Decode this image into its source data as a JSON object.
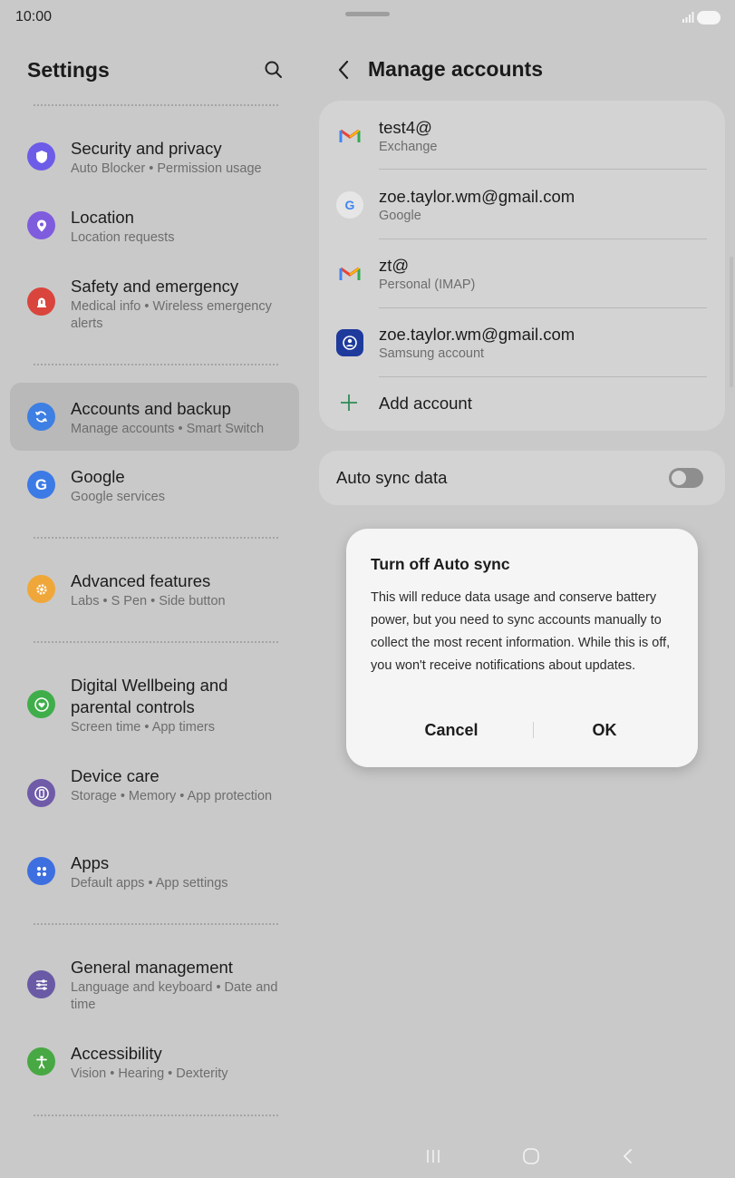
{
  "status_bar": {
    "time": "10:00"
  },
  "left_pane": {
    "title": "Settings",
    "items": [
      {
        "label": "Security and privacy",
        "sub": "Auto Blocker  •  Permission usage",
        "icon": "shield-icon",
        "color": "#6d5ce8"
      },
      {
        "label": "Location",
        "sub": "Location requests",
        "icon": "location-pin-icon",
        "color": "#7f5cde"
      },
      {
        "label": "Safety and emergency",
        "sub": "Medical info  •  Wireless emergency alerts",
        "icon": "emergency-icon",
        "color": "#d9453d"
      },
      {
        "label": "Accounts and backup",
        "sub": "Manage accounts  •  Smart Switch",
        "icon": "sync-icon",
        "color": "#3e7fe3"
      },
      {
        "label": "Google",
        "sub": "Google services",
        "icon": "google-g-icon",
        "color": "#3c7ae6"
      },
      {
        "label": "Advanced features",
        "sub": "Labs  •  S Pen  •  Side button",
        "icon": "gear-plus-icon",
        "color": "#f0a73a"
      },
      {
        "label": "Digital Wellbeing and parental controls",
        "sub": "Screen time  •  App timers",
        "icon": "heart-circle-icon",
        "color": "#3fae4a"
      },
      {
        "label": "Device care",
        "sub": "Storage  •  Memory  •  App protection",
        "icon": "device-care-icon",
        "color": "#6f5ba8"
      },
      {
        "label": "Apps",
        "sub": "Default apps  •  App settings",
        "icon": "apps-grid-icon",
        "color": "#3e6fe0"
      },
      {
        "label": "General management",
        "sub": "Language and keyboard  •  Date and time",
        "icon": "sliders-icon",
        "color": "#6a5aa6"
      },
      {
        "label": "Accessibility",
        "sub": "Vision  •  Hearing  •  Dexterity",
        "icon": "accessibility-icon",
        "color": "#48a843"
      }
    ]
  },
  "right_pane": {
    "title": "Manage accounts",
    "accounts": [
      {
        "name": "test4@",
        "type": "Exchange",
        "icon": "gmail-icon"
      },
      {
        "name": "zoe.taylor.wm@gmail.com",
        "type": "Google",
        "icon": "google-icon"
      },
      {
        "name": "zt@",
        "type": "Personal (IMAP)",
        "icon": "gmail-icon"
      },
      {
        "name": "zoe.taylor.wm@gmail.com",
        "type": "Samsung account",
        "icon": "samsung-account-icon"
      }
    ],
    "add_account_label": "Add account",
    "auto_sync": {
      "label": "Auto sync data",
      "enabled": false
    }
  },
  "dialog": {
    "title": "Turn off Auto sync",
    "body": "This will reduce data usage and conserve battery power, but you need to sync accounts manually to collect the most recent information. While this is off, you won't receive notifications about updates.",
    "cancel_label": "Cancel",
    "ok_label": "OK"
  }
}
